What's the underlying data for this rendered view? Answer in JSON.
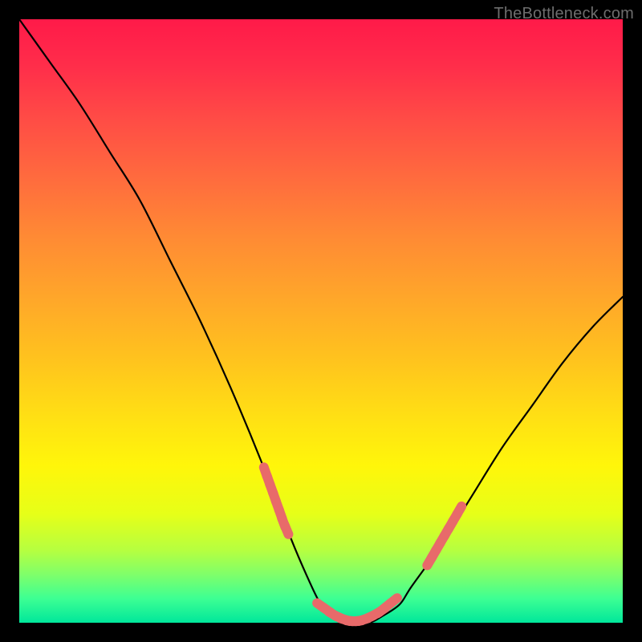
{
  "attribution": "TheBottleneck.com",
  "colors": {
    "page_bg": "#000000",
    "gradient_top": "#ff1a49",
    "gradient_mid": "#ffe014",
    "gradient_bottom": "#00e79b",
    "curve": "#000000",
    "dots": "#e86a6a"
  },
  "chart_data": {
    "type": "line",
    "title": "",
    "xlabel": "",
    "ylabel": "",
    "xlim": [
      0,
      100
    ],
    "ylim": [
      0,
      100
    ],
    "series": [
      {
        "name": "bottleneck-curve",
        "x": [
          0,
          5,
          10,
          15,
          20,
          25,
          30,
          35,
          40,
          45,
          48,
          50,
          52,
          55,
          58,
          60,
          63,
          65,
          70,
          75,
          80,
          85,
          90,
          95,
          100
        ],
        "y": [
          100,
          93,
          86,
          78,
          70,
          60,
          50,
          39,
          27,
          14,
          7,
          3,
          1,
          0,
          0,
          1,
          3,
          6,
          13,
          21,
          29,
          36,
          43,
          49,
          54
        ]
      }
    ],
    "dot_clusters": [
      {
        "name": "left-cluster",
        "x": [
          40.8,
          41.3,
          41.8,
          42.3,
          42.8,
          43.3,
          43.8,
          44.3
        ],
        "y": [
          25.0,
          23.6,
          22.2,
          20.8,
          19.4,
          18.0,
          16.6,
          15.4
        ]
      },
      {
        "name": "bottom-cluster",
        "x": [
          50.0,
          51.0,
          52.0,
          53.0,
          54.0,
          55.0,
          56.0,
          57.0,
          58.0,
          59.0,
          60.0,
          61.0,
          62.0
        ],
        "y": [
          2.8,
          2.1,
          1.4,
          0.9,
          0.5,
          0.3,
          0.3,
          0.5,
          0.9,
          1.4,
          2.0,
          2.8,
          3.6
        ]
      },
      {
        "name": "right-cluster",
        "x": [
          68.0,
          68.7,
          69.4,
          70.1,
          70.8,
          71.5,
          72.2,
          72.9
        ],
        "y": [
          10.2,
          11.4,
          12.6,
          13.8,
          15.0,
          16.2,
          17.4,
          18.6
        ]
      }
    ]
  }
}
